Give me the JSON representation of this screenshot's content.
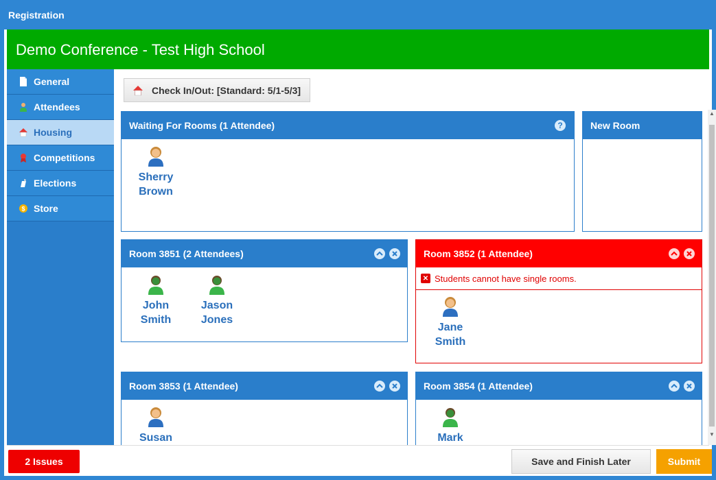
{
  "window": {
    "title": "Registration"
  },
  "header": {
    "title": "Demo Conference - Test High School"
  },
  "sidebar": {
    "items": [
      {
        "label": "General",
        "icon": "document-icon"
      },
      {
        "label": "Attendees",
        "icon": "person-icon"
      },
      {
        "label": "Housing",
        "icon": "house-icon",
        "active": true
      },
      {
        "label": "Competitions",
        "icon": "ribbon-icon"
      },
      {
        "label": "Elections",
        "icon": "ballot-icon"
      },
      {
        "label": "Store",
        "icon": "coin-icon"
      }
    ]
  },
  "checkin": {
    "label": "Check In/Out: [Standard: 5/1-5/3]"
  },
  "waiting": {
    "title": "Waiting For Rooms (1 Attendee)",
    "help": "?",
    "attendees": [
      {
        "first": "Sherry",
        "last": "Brown",
        "gender": "female"
      }
    ]
  },
  "new_room": {
    "title": "New Room"
  },
  "rooms": [
    {
      "title": "Room 3851 (2 Attendees)",
      "attendees": [
        {
          "first": "John",
          "last": "Smith",
          "gender": "male"
        },
        {
          "first": "Jason",
          "last": "Jones",
          "gender": "male"
        }
      ]
    },
    {
      "title": "Room 3852 (1 Attendee)",
      "error": "Students cannot have single rooms.",
      "attendees": [
        {
          "first": "Jane",
          "last": "Smith",
          "gender": "female"
        }
      ]
    },
    {
      "title": "Room 3853 (1 Attendee)",
      "attendees": [
        {
          "first": "Susan",
          "last": "",
          "gender": "female"
        }
      ]
    },
    {
      "title": "Room 3854 (1 Attendee)",
      "attendees": [
        {
          "first": "Mark",
          "last": "",
          "gender": "male"
        }
      ]
    }
  ],
  "footer": {
    "issues": "2 Issues",
    "save": "Save and Finish Later",
    "submit": "Submit"
  },
  "colors": {
    "brand_blue": "#2a7ecb",
    "header_green": "#00aa00",
    "error_red": "#ff0000",
    "submit_orange": "#f5a100"
  }
}
